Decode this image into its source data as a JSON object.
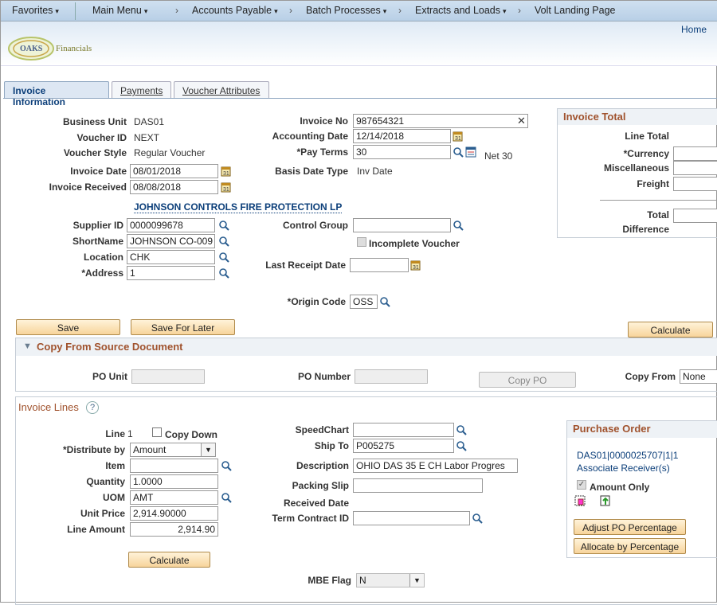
{
  "nav": {
    "favorites": "Favorites",
    "main_menu": "Main Menu",
    "crumbs": [
      "Accounts Payable",
      "Batch Processes",
      "Extracts and Loads",
      "Volt Landing Page"
    ],
    "sep": "›",
    "caret": "▾"
  },
  "header": {
    "home": "Home",
    "logo_oaks": "OAKS",
    "logo_financials": "Financials"
  },
  "tabs": [
    "Invoice Information",
    "Payments",
    "Voucher Attributes"
  ],
  "invoice": {
    "business_unit_label": "Business Unit",
    "business_unit": "DAS01",
    "voucher_id_label": "Voucher ID",
    "voucher_id": "NEXT",
    "voucher_style_label": "Voucher Style",
    "voucher_style": "Regular Voucher",
    "invoice_date_label": "Invoice Date",
    "invoice_date": "08/01/2018",
    "invoice_received_label": "Invoice Received",
    "invoice_received": "08/08/2018",
    "invoice_no_label": "Invoice No",
    "invoice_no": "987654321",
    "accounting_date_label": "Accounting Date",
    "accounting_date": "12/14/2018",
    "pay_terms_label": "*Pay Terms",
    "pay_terms": "30",
    "pay_terms_desc": "Net 30",
    "basis_date_type_label": "Basis Date Type",
    "basis_date_type": "Inv Date",
    "supplier_name": "JOHNSON CONTROLS FIRE PROTECTION LP",
    "supplier_id_label": "Supplier ID",
    "supplier_id": "0000099678",
    "shortname_label": "ShortName",
    "shortname": "JOHNSON CO-009",
    "location_label": "Location",
    "location": "CHK",
    "address_label": "*Address",
    "address": "1",
    "control_group_label": "Control Group",
    "control_group": "",
    "incomplete_voucher_label": "Incomplete Voucher",
    "last_receipt_date_label": "Last Receipt Date",
    "last_receipt_date": "",
    "origin_code_label": "*Origin Code",
    "origin_code": "OSS"
  },
  "invoice_total": {
    "title": "Invoice Total",
    "line_total_label": "Line Total",
    "currency_label": "*Currency",
    "misc_label": "Miscellaneous",
    "freight_label": "Freight",
    "total_label": "Total",
    "difference_label": "Difference"
  },
  "buttons": {
    "save": "Save",
    "save_for_later": "Save For Later",
    "calculate": "Calculate",
    "copy_po": "Copy PO",
    "calculate_lines": "Calculate",
    "adjust_po": "Adjust PO Percentage",
    "allocate": "Allocate by Percentage"
  },
  "copy_source": {
    "title": "Copy From Source Document",
    "po_unit_label": "PO Unit",
    "po_unit": "",
    "po_number_label": "PO Number",
    "po_number": "",
    "copy_from_label": "Copy From",
    "copy_from": "None"
  },
  "invoice_lines": {
    "title": "Invoice Lines",
    "help": "?",
    "line_label": "Line",
    "line": "1",
    "copy_down_label": "Copy Down",
    "distribute_by_label": "*Distribute by",
    "distribute_by": "Amount",
    "item_label": "Item",
    "item": "",
    "quantity_label": "Quantity",
    "quantity": "1.0000",
    "uom_label": "UOM",
    "uom": "AMT",
    "unit_price_label": "Unit Price",
    "unit_price": "2,914.90000",
    "line_amount_label": "Line Amount",
    "line_amount": "2,914.90",
    "speedchart_label": "SpeedChart",
    "speedchart": "",
    "ship_to_label": "Ship To",
    "ship_to": "P005275",
    "description_label": "Description",
    "description": "OHIO DAS 35 E CH Labor Progres",
    "packing_slip_label": "Packing Slip",
    "packing_slip": "",
    "received_date_label": "Received Date",
    "term_contract_label": "Term Contract ID",
    "term_contract": "",
    "mbe_flag_label": "MBE Flag",
    "mbe_flag": "N"
  },
  "purchase_order": {
    "title": "Purchase Order",
    "po_link": "DAS01|0000025707|1|1",
    "associate_receivers": "Associate Receiver(s)",
    "amount_only_label": "Amount Only"
  },
  "colors": {
    "accent": "#a0522d",
    "link": "#0c3f7a",
    "button": "#f7d49b"
  }
}
